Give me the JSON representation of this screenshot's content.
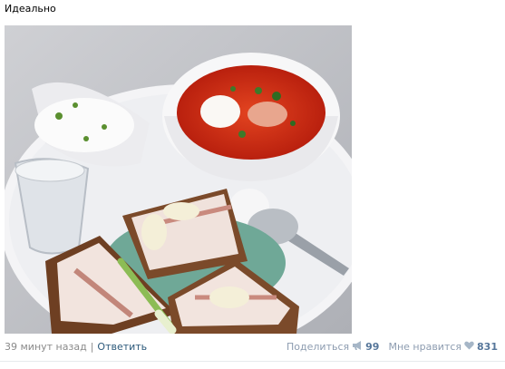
{
  "post": {
    "text": "Идеально"
  },
  "footer": {
    "time": "39 минут назад",
    "separator": "|",
    "reply_label": "Ответить",
    "share_label": "Поделиться",
    "share_count": "99",
    "like_label": "Мне нравится",
    "like_count": "831"
  },
  "icons": {
    "share": "megaphone-icon",
    "like": "heart-icon"
  },
  "colors": {
    "link": "#2b587a",
    "muted": "#8a8a8a",
    "action": "#8d9cb0",
    "count": "#56769a"
  }
}
